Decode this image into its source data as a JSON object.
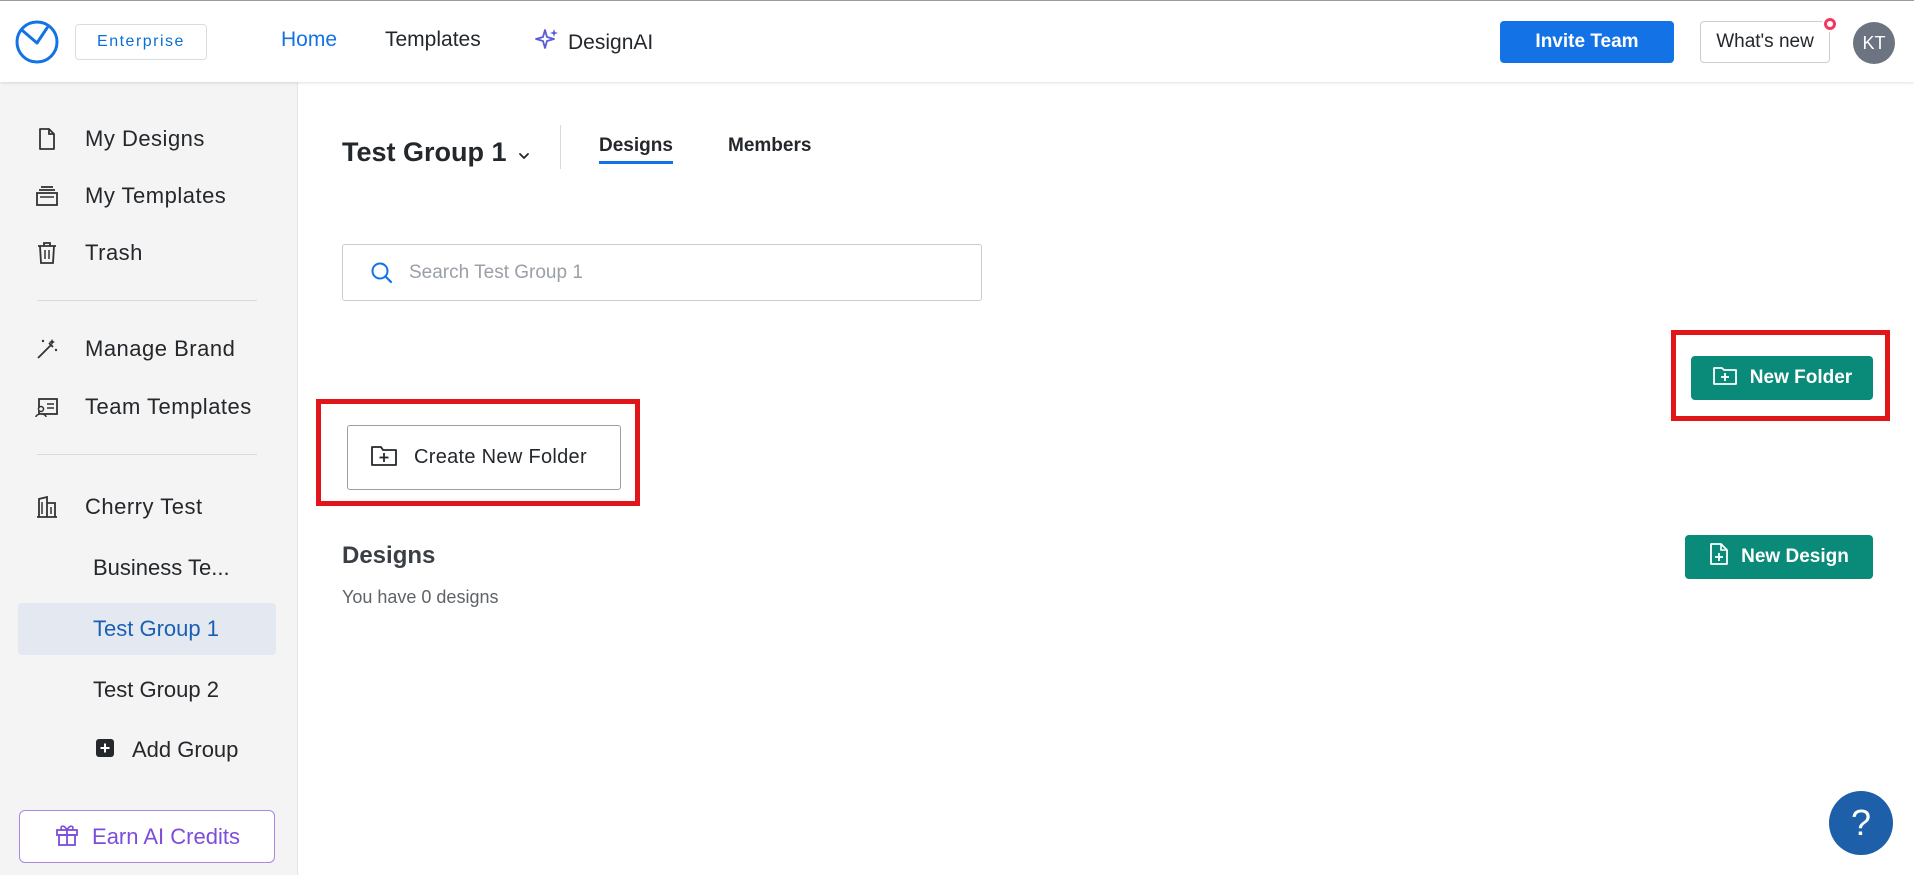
{
  "header": {
    "plan_badge": "Enterprise",
    "nav": {
      "home": "Home",
      "templates": "Templates",
      "designai": "DesignAI"
    },
    "invite_button": "Invite Team",
    "whats_new_button": "What's new",
    "avatar_initials": "KT"
  },
  "sidebar": {
    "items": {
      "my_designs": "My Designs",
      "my_templates": "My Templates",
      "trash": "Trash",
      "manage_brand": "Manage Brand",
      "team_templates": "Team Templates",
      "workspace": "Cherry Test"
    },
    "groups": [
      "Business Te...",
      "Test Group 1",
      "Test Group 2"
    ],
    "active_group": "Test Group 1",
    "add_group": "Add Group",
    "earn_credits": "Earn AI Credits"
  },
  "main": {
    "group_title": "Test Group 1",
    "tabs": {
      "designs": "Designs",
      "members": "Members"
    },
    "active_tab": "Designs",
    "search_placeholder": "Search Test Group 1",
    "new_folder_button": "New Folder",
    "create_folder_button": "Create New Folder",
    "designs_heading": "Designs",
    "designs_count_text": "You have 0 designs",
    "new_design_button": "New Design"
  },
  "help_button": "?",
  "colors": {
    "accent_blue": "#1373e6",
    "teal_button": "#0a8a78",
    "highlight_red": "#e0161b",
    "active_group_bg": "#e4e9f1"
  }
}
